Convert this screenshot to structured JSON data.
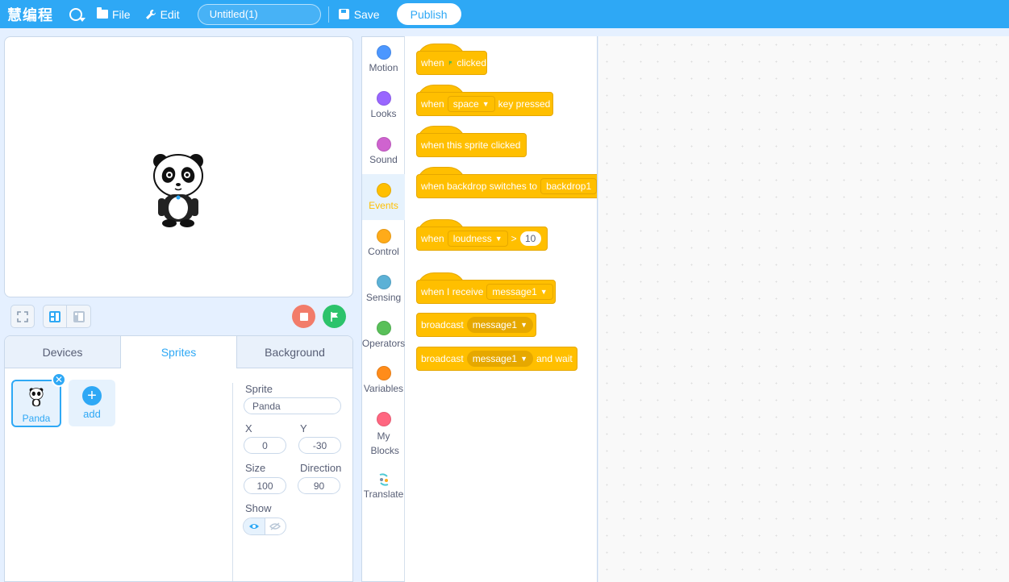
{
  "app": {
    "brand": "慧编程",
    "title_value": "Untitled(1)"
  },
  "menubar": {
    "file_label": "File",
    "edit_label": "Edit",
    "save_label": "Save",
    "publish_label": "Publish"
  },
  "tabs": [
    {
      "label": "Devices",
      "active": false
    },
    {
      "label": "Sprites",
      "active": true
    },
    {
      "label": "Background",
      "active": false
    }
  ],
  "sprites": [
    {
      "name": "Panda",
      "selected": true
    }
  ],
  "add_label": "add",
  "sprite_props": {
    "sprite_label": "Sprite",
    "sprite_value": "Panda",
    "x_label": "X",
    "x_value": "0",
    "y_label": "Y",
    "y_value": "-30",
    "size_label": "Size",
    "size_value": "100",
    "direction_label": "Direction",
    "direction_value": "90",
    "show_label": "Show",
    "show_visible": true
  },
  "categories": [
    {
      "label": "Motion",
      "color": "#4c97ff"
    },
    {
      "label": "Looks",
      "color": "#9966ff"
    },
    {
      "label": "Sound",
      "color": "#cf63cf"
    },
    {
      "label": "Events",
      "color": "#ffbf00",
      "active": true
    },
    {
      "label": "Control",
      "color": "#ffab19"
    },
    {
      "label": "Sensing",
      "color": "#5cb1d6"
    },
    {
      "label": "Operators",
      "color": "#59c059"
    },
    {
      "label": "Variables",
      "color": "#ff8c1a"
    },
    {
      "label": "My Blocks",
      "color": "#ff6680"
    },
    {
      "label": "Translate",
      "color": "#4ec9d4"
    }
  ],
  "blocks": {
    "when_flag": {
      "a": "when",
      "b": "clicked"
    },
    "when_key": {
      "a": "when",
      "dd": "space",
      "b": "key pressed"
    },
    "when_sprite": {
      "a": "when this sprite clicked"
    },
    "when_backdrop": {
      "a": "when backdrop switches to",
      "dd": "backdrop1"
    },
    "when_loudness": {
      "a": "when",
      "dd": "loudness",
      "op": ">",
      "num": "10"
    },
    "when_receive": {
      "a": "when I receive",
      "dd": "message1"
    },
    "broadcast": {
      "a": "broadcast",
      "dd": "message1"
    },
    "broadcast_wait": {
      "a": "broadcast",
      "dd": "message1",
      "b": "and wait"
    }
  },
  "colors": {
    "accent": "#2ea8f5",
    "events": "#ffbf00",
    "stop": "#f27c6a",
    "go": "#2cc36b"
  }
}
